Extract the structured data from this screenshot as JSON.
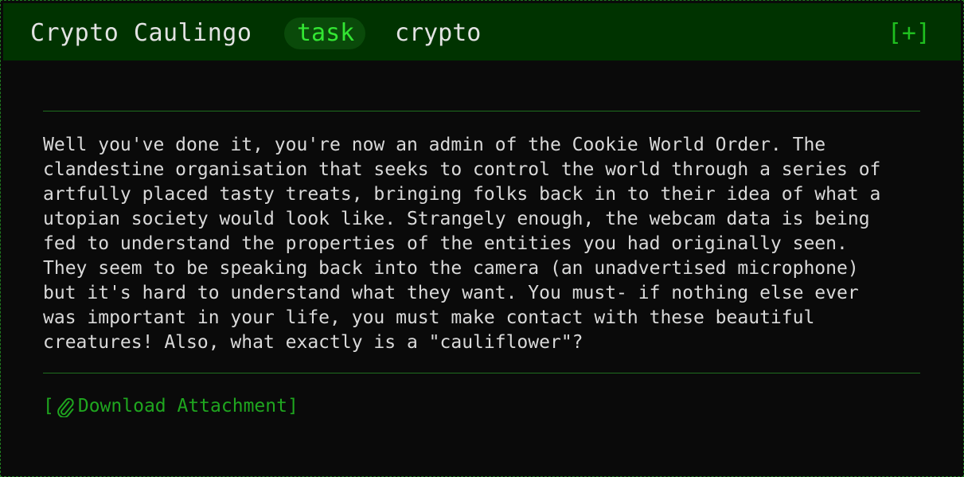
{
  "challenge": {
    "title": "Crypto Caulingo",
    "tag": "task",
    "category": "crypto",
    "expand_label": "[+]",
    "description": "Well you've done it, you're now an admin of the Cookie World Order. The\nclandestine organisation that seeks to control the world through a series of\nartfully placed tasty treats, bringing folks back in to their idea of what a\nutopian society would look like. Strangely enough, the webcam data is being\nfed to understand the properties of the entities you had originally seen.\nThey seem to be speaking back into the camera (an unadvertised microphone)\nbut it's hard to understand what they want. You must- if nothing else ever\nwas important in your life, you must make contact with these beautiful\ncreatures! Also, what exactly is a \"cauliflower\"?",
    "attachment": {
      "open_bracket": "[",
      "icon": "paperclip-icon",
      "label": "Download Attachment",
      "close_bracket": "]"
    }
  },
  "colors": {
    "header_bg": "#003300",
    "accent_green": "#33e633",
    "link_green": "#1fa61f",
    "body_bg": "#0a0a0a",
    "text": "#d9d9d9"
  }
}
